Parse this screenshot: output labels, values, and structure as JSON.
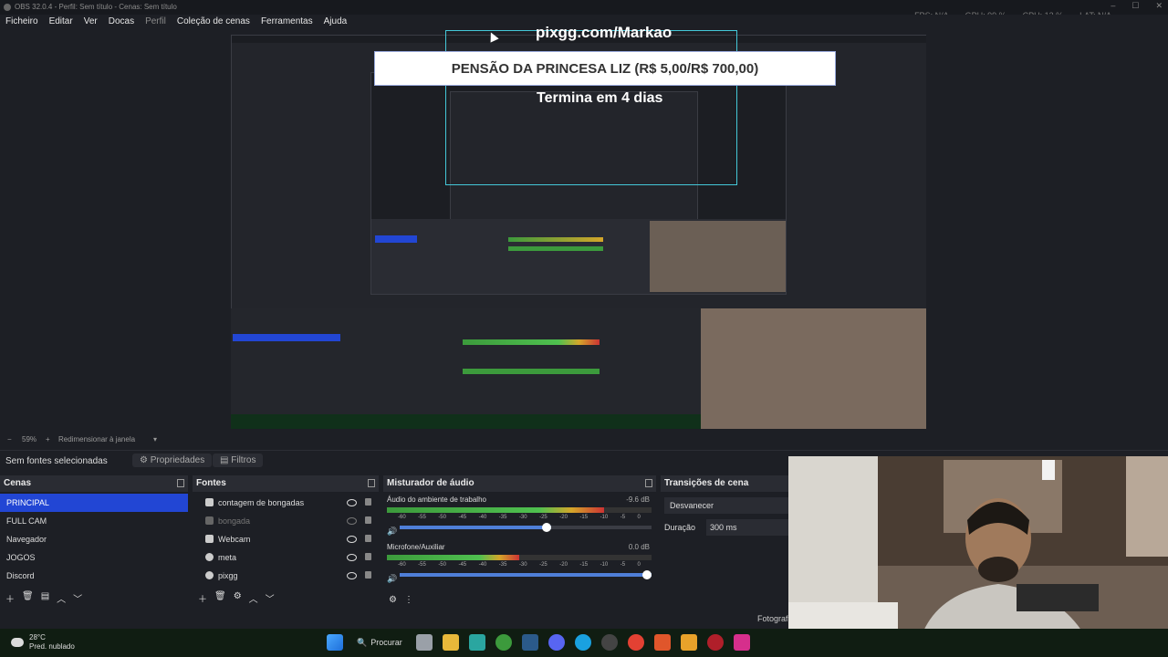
{
  "window": {
    "title": "OBS 32.0.4 - Perfil: Sem título - Cenas: Sem título",
    "stats": [
      "FPS: N/A",
      "GPU: 99 %",
      "CPU: 12 %",
      "LAT: N/A"
    ]
  },
  "menu": [
    "Ficheiro",
    "Editar",
    "Ver",
    "Docas",
    "Perfil",
    "Coleção de cenas",
    "Ferramentas",
    "Ajuda"
  ],
  "overlay": {
    "link": "pixgg.com/Markao",
    "banner": "PENSÃO DA PRINCESA LIZ (R$ 5,00/R$ 700,00)",
    "ends": "Termina em 4 dias"
  },
  "zoom": {
    "minus": "−",
    "value": "59%",
    "plus": "+",
    "mode": "Redimensionar à janela",
    "chevron": "▾"
  },
  "source_bar": {
    "no_source": "Sem fontes selecionadas",
    "properties": "Propriedades",
    "filters": "Filtros"
  },
  "scenes": {
    "title": "Cenas",
    "items": [
      "PRINCIPAL",
      "FULL CAM",
      "Navegador",
      "JOGOS",
      "Discord"
    ],
    "selected": 0
  },
  "sources": {
    "title": "Fontes",
    "items": [
      {
        "name": "contagem de bongadas",
        "visible": true
      },
      {
        "name": "bongada",
        "visible": false
      },
      {
        "name": "Webcam",
        "visible": true
      },
      {
        "name": "meta",
        "visible": true
      },
      {
        "name": "pixgg",
        "visible": true
      }
    ]
  },
  "mixer": {
    "title": "Misturador de áudio",
    "tracks": [
      {
        "name": "Áudio do ambiente de trabalho",
        "db": "-9.6 dB",
        "level": 0.82,
        "volume": 0.6
      },
      {
        "name": "Microfone/Auxiliar",
        "db": "0.0 dB",
        "level": 0.5,
        "volume": 1.0
      }
    ],
    "scale": [
      "-60",
      "-55",
      "-50",
      "-45",
      "-40",
      "-35",
      "-30",
      "-25",
      "-20",
      "-15",
      "-10",
      "-5",
      "0"
    ]
  },
  "transitions": {
    "title": "Transições de cena",
    "current": "Desvanecer",
    "duration_label": "Duração",
    "duration": "300 ms"
  },
  "misc": {
    "fotograf": "Fotograf"
  },
  "taskbar": {
    "temp": "28°C",
    "weather": "Pred. nublado",
    "search": "Procurar",
    "colors": {
      "accent": "#2246d4",
      "taskbar": "#101d12"
    }
  }
}
